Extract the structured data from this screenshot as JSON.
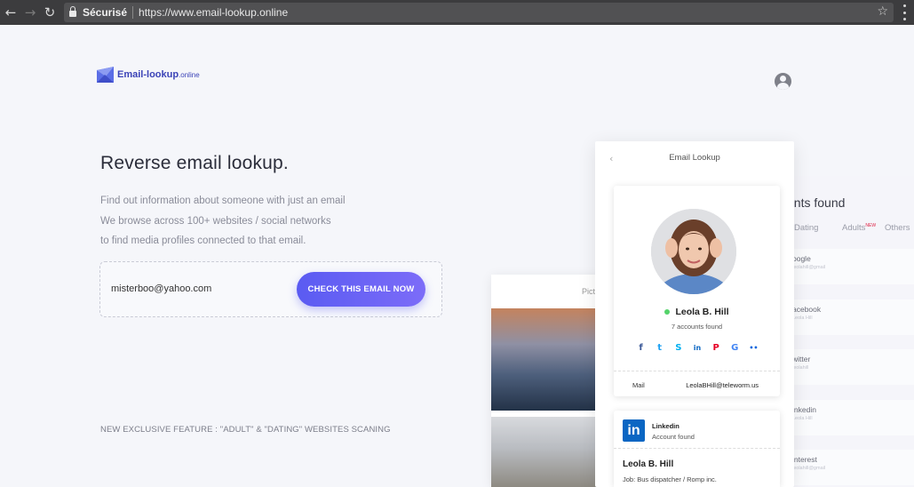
{
  "browser": {
    "secure_label": "Sécurisé",
    "url": "https://www.email-lookup.online"
  },
  "brand": {
    "name": "Email-lookup",
    "tld": ".online",
    "color": "#3b43b7"
  },
  "hero": {
    "title": "Reverse email lookup.",
    "lines": [
      "Find out information about someone with just an email",
      "We browse across 100+ websites / social networks",
      "to find media profiles connected to that email."
    ]
  },
  "form": {
    "email_value": "misterboo@yahoo.com",
    "button_label": "CHECK THIS EMAIL NOW",
    "accent": "#5a5bf2"
  },
  "feature_note": "NEW EXCLUSIVE FEATURE : \"ADULT\" & \"DATING\" WEBSITES SCANING",
  "results_panel": {
    "title": "unts found",
    "tabs": [
      "Dating",
      "Adults",
      "Others"
    ],
    "adults_badge": "NEW",
    "items": [
      {
        "name": "oogle",
        "sub": "leolahill@gmail"
      },
      {
        "name": "acebook",
        "sub": "Leola Hill"
      },
      {
        "name": "witter",
        "sub": "leolahill"
      },
      {
        "name": "inkedin",
        "sub": "Leola Hill"
      },
      {
        "name": "interest",
        "sub": "leolahill@gmail"
      }
    ]
  },
  "back_card": {
    "title": "Pict"
  },
  "phone": {
    "title": "Email Lookup",
    "profile": {
      "name": "Leola B. Hill",
      "accounts": "7 accounts found",
      "socials": [
        {
          "icon": "facebook-icon",
          "glyph": "f",
          "color": "#3b5998"
        },
        {
          "icon": "twitter-icon",
          "glyph": "t",
          "color": "#1da1f2"
        },
        {
          "icon": "skype-icon",
          "glyph": "S",
          "color": "#00aff0"
        },
        {
          "icon": "linkedin-icon",
          "glyph": "in",
          "color": "#0b66c3"
        },
        {
          "icon": "pinterest-icon",
          "glyph": "P",
          "color": "#e60023"
        },
        {
          "icon": "google-icon",
          "glyph": "G",
          "color": "#4285f4"
        },
        {
          "icon": "flickr-icon",
          "glyph": "••",
          "color": "#0063dc"
        }
      ],
      "mail_label": "Mail",
      "mail_value": "LeolaBHill@teleworm.us"
    },
    "linkedin": {
      "network": "Linkedin",
      "status": "Account found",
      "person": "Leola B. Hill",
      "job": "Job: Bus dispatcher / Romp  inc."
    }
  }
}
